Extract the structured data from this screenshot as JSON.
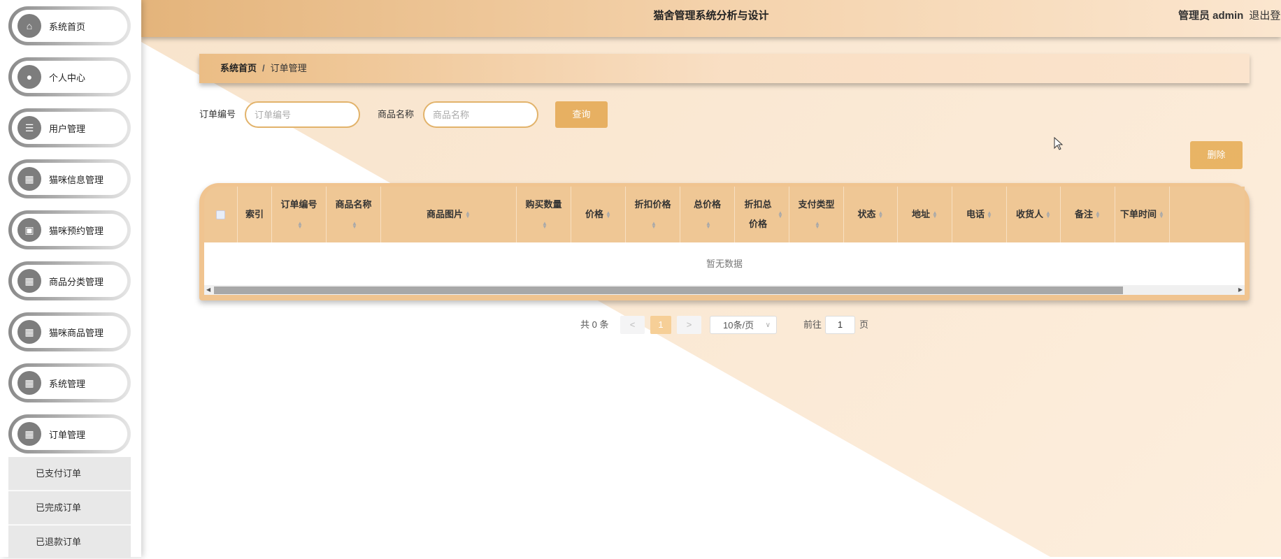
{
  "header": {
    "title": "猫舍管理系统分析与设计",
    "user": "管理员 admin",
    "logout": "退出登录"
  },
  "sidebar": {
    "items": [
      {
        "label": "系统首页",
        "icon": "home-icon"
      },
      {
        "label": "个人中心",
        "icon": "user-icon"
      },
      {
        "label": "用户管理",
        "icon": "sliders-icon"
      },
      {
        "label": "猫咪信息管理",
        "icon": "grid-icon"
      },
      {
        "label": "猫咪预约管理",
        "icon": "plugin-icon"
      },
      {
        "label": "商品分类管理",
        "icon": "grid-icon"
      },
      {
        "label": "猫咪商品管理",
        "icon": "grid-icon"
      },
      {
        "label": "系统管理",
        "icon": "grid-icon"
      },
      {
        "label": "订单管理",
        "icon": "grid-icon"
      }
    ],
    "sub_items": [
      "已支付订单",
      "已完成订单",
      "已退款订单"
    ]
  },
  "breadcrumb": {
    "home": "系统首页",
    "sep": "/",
    "current": "订单管理"
  },
  "search": {
    "order_label": "订单编号",
    "order_placeholder": "订单编号",
    "order_value": "",
    "goods_label": "商品名称",
    "goods_placeholder": "商品名称",
    "goods_value": "",
    "query": "查询"
  },
  "actions": {
    "delete": "删除"
  },
  "table": {
    "columns": [
      "索引",
      "订单编号",
      "商品名称",
      "商品图片",
      "购买数量",
      "价格",
      "折扣价格",
      "总价格",
      "折扣总价格",
      "支付类型",
      "状态",
      "地址",
      "电话",
      "收货人",
      "备注",
      "下单时间"
    ],
    "empty": "暂无数据"
  },
  "pagination": {
    "total": "共 0 条",
    "prev": "<",
    "page": "1",
    "next": ">",
    "page_size": "10条/页",
    "goto": "前往",
    "goto_value": "1",
    "page_unit": "页"
  },
  "colors": {
    "accent": "#e7b062",
    "header_start": "#e4b47b"
  }
}
